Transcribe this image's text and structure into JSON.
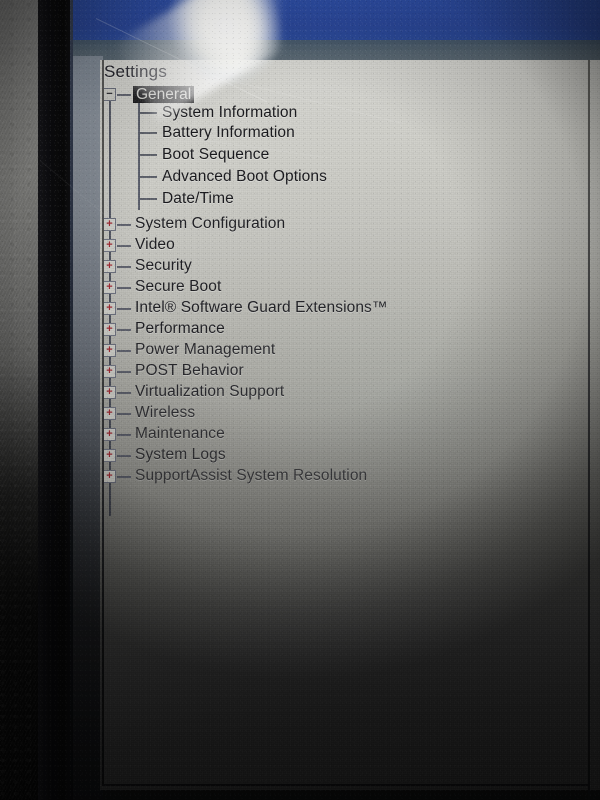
{
  "screen": {
    "title": "Settings",
    "colors": {
      "panel_light": "#d7d7d2",
      "panel_dark": "#2a2a2a",
      "header_blue": "#2b489b",
      "selection_bg": "#232326",
      "selection_text": "#d8d8d4",
      "expand_icon": "#a32a33",
      "tree_line": "#4d5160",
      "text": "#1b1b1f"
    }
  },
  "tree": {
    "root": {
      "label": "General",
      "toggle_icon": "minus-box-icon",
      "toggle_glyph": "−",
      "expanded": true,
      "selected": true,
      "children": [
        {
          "label": "System Information"
        },
        {
          "label": "Battery Information"
        },
        {
          "label": "Boot Sequence"
        },
        {
          "label": "Advanced Boot Options"
        },
        {
          "label": "Date/Time"
        }
      ]
    },
    "toggle_glyph_collapsed": "+",
    "toggle_icon_collapsed": "plus-box-icon",
    "items": [
      {
        "label": "System Configuration",
        "expanded": false
      },
      {
        "label": "Video",
        "expanded": false
      },
      {
        "label": "Security",
        "expanded": false
      },
      {
        "label": "Secure Boot",
        "expanded": false
      },
      {
        "label": "Intel® Software Guard Extensions™",
        "expanded": false
      },
      {
        "label": "Performance",
        "expanded": false
      },
      {
        "label": "Power Management",
        "expanded": false
      },
      {
        "label": "POST Behavior",
        "expanded": false
      },
      {
        "label": "Virtualization Support",
        "expanded": false
      },
      {
        "label": "Wireless",
        "expanded": false
      },
      {
        "label": "Maintenance",
        "expanded": false
      },
      {
        "label": "System Logs",
        "expanded": false
      },
      {
        "label": "SupportAssist System Resolution",
        "expanded": false
      }
    ]
  }
}
